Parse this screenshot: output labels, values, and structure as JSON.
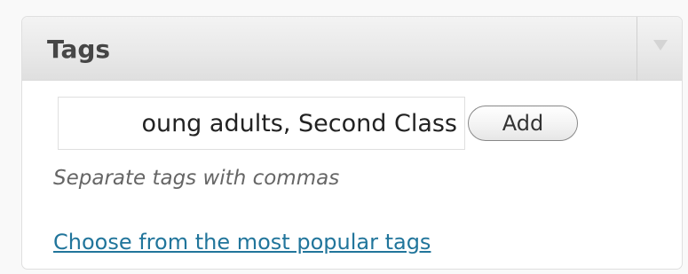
{
  "tags_box": {
    "title": "Tags",
    "toggle_icon": "triangle-down-icon",
    "input_value": "oung adults, Second Class",
    "add_label": "Add",
    "howto": "Separate tags with commas",
    "popular_link": "Choose from the most popular tags"
  },
  "colors": {
    "link": "#21759b",
    "header_bg": "#e9e9e9",
    "title_text": "#464646",
    "hint_text": "#666666"
  }
}
